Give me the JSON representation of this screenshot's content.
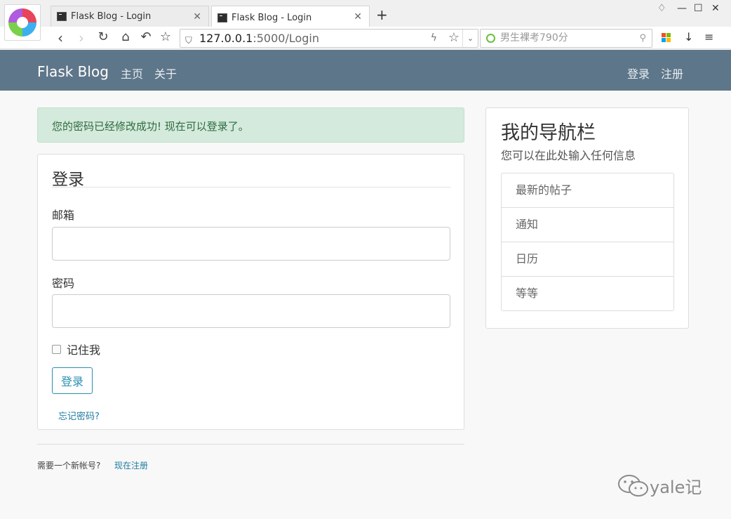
{
  "browser": {
    "tabs": [
      {
        "title": "Flask Blog - Login",
        "active": false
      },
      {
        "title": "Flask Blog - Login",
        "active": true
      }
    ],
    "url_host": "127.0.0.1",
    "url_path": ":5000/Login",
    "search_placeholder": "男生裸考790分"
  },
  "navbar": {
    "brand": "Flask Blog",
    "links": [
      "主页",
      "关于"
    ],
    "right_links": [
      "登录",
      "注册"
    ]
  },
  "alert": {
    "message": "您的密码已经修改成功! 现在可以登录了。"
  },
  "login_form": {
    "title": "登录",
    "email_label": "邮箱",
    "email_value": "",
    "password_label": "密码",
    "password_value": "",
    "remember_label": "记住我",
    "remember_checked": false,
    "submit_label": "登录",
    "forgot_link": "忘记密码?"
  },
  "footer": {
    "prompt": "需要一个新帐号?",
    "register_link": "现在注册"
  },
  "sidebar": {
    "title": "我的导航栏",
    "subtitle": "您可以在此处输入任何信息",
    "items": [
      "最新的帖子",
      "通知",
      "日历",
      "等等"
    ]
  },
  "watermark": "yale记",
  "colors": {
    "navbar_bg": "#5e7689",
    "alert_bg": "#d4eadc",
    "alert_text": "#2e6b40",
    "link": "#1f7aa1",
    "button_border": "#2a8fb0"
  }
}
